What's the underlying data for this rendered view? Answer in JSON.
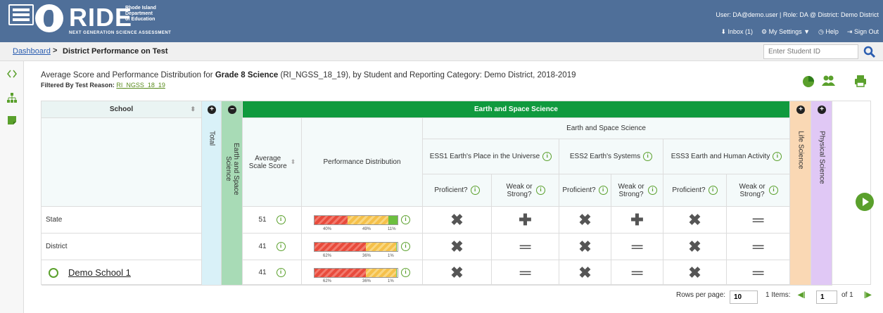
{
  "header": {
    "brand": "RIDE",
    "brand_sub": "Rhode Island\nDepartment\nof Education",
    "brand_ngsa": "NEXT GENERATION SCIENCE ASSESSMENT",
    "user_line": "User: DA@demo.user  |  Role: DA @ District: Demo District",
    "inbox": "Inbox (1)",
    "settings": "My Settings ▼",
    "help": "Help",
    "signout": "Sign Out"
  },
  "breadcrumb": {
    "link": "Dashboard",
    "sep": ">",
    "title": "District Performance on Test"
  },
  "search": {
    "placeholder": "Enter Student ID"
  },
  "report": {
    "title_prefix": "Average Score and Performance Distribution for ",
    "title_bold": "Grade 8 Science",
    "title_suffix": " (RI_NGSS_18_19), by Student and Reporting Category: Demo District, 2018-2019",
    "filter_label": "Filtered By Test Reason: ",
    "filter_value": "RI_NGSS_18_19"
  },
  "table": {
    "school_header": "School",
    "total_header": "Total",
    "ess_vertical": "Earth and Space Science",
    "ess_group": "Earth and Space Science",
    "ess_sub": "Earth and Space Science",
    "avg_scale_score": "Average Scale Score",
    "perf_dist": "Performance Distribution",
    "ess1": "ESS1 Earth's Place in the Universe",
    "ess2": "ESS2 Earth's Systems",
    "ess3": "ESS3 Earth and Human Activity",
    "proficient": "Proficient?",
    "weak_strong": "Weak or Strong?",
    "life_science": "Life Science",
    "physical_science": "Physical Science",
    "rows": [
      {
        "name": "State",
        "score": "51",
        "dist": [
          40,
          49,
          11
        ],
        "labels": [
          "40%",
          "49%",
          "11%"
        ],
        "marks": [
          "x",
          "+",
          "x",
          "+",
          "x",
          "="
        ]
      },
      {
        "name": "District",
        "score": "41",
        "dist": [
          62,
          36,
          1
        ],
        "labels": [
          "62%",
          "36%",
          "1%"
        ],
        "marks": [
          "x",
          "=",
          "x",
          "=",
          "x",
          "="
        ]
      },
      {
        "name": "Demo School 1",
        "score": "41",
        "dist": [
          62,
          36,
          1
        ],
        "labels": [
          "62%",
          "36%",
          "1%"
        ],
        "marks": [
          "x",
          "=",
          "x",
          "=",
          "x",
          "="
        ]
      }
    ]
  },
  "pager": {
    "rows_label": "Rows per page:",
    "rows_value": "10",
    "items": "1 Items:",
    "page": "1",
    "of": "of 1"
  }
}
